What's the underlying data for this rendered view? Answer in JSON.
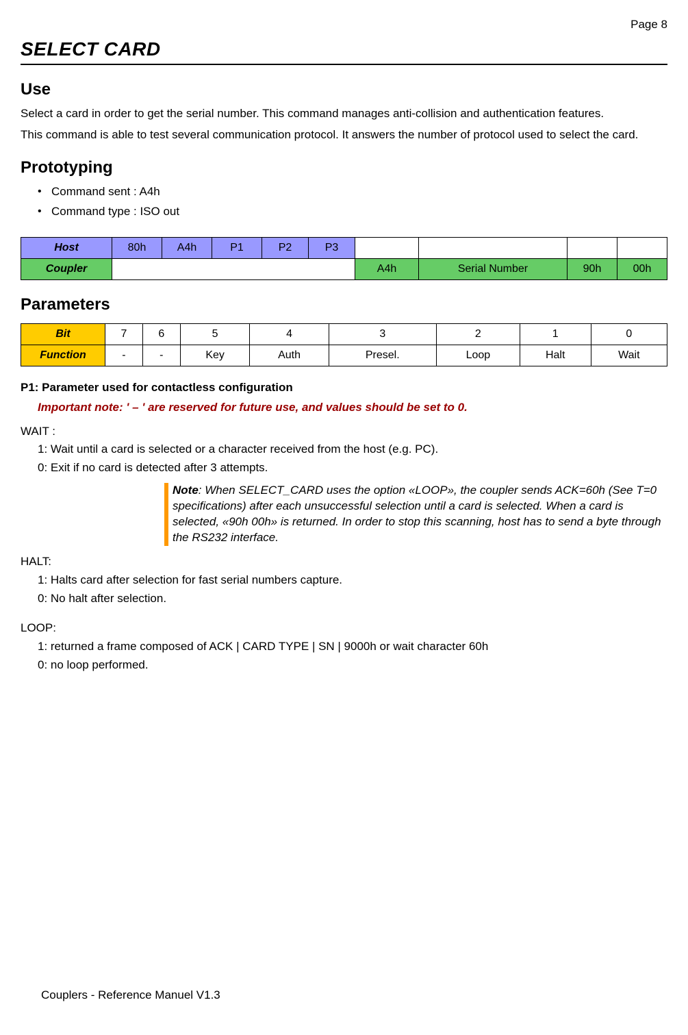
{
  "page_number": "Page 8",
  "title": "SELECT CARD",
  "use": {
    "heading": "Use",
    "p1": "Select a card in order to get the serial number. This command manages anti-collision and  authentication features.",
    "p2": "This command is able to test several communication protocol. It answers the number of protocol used to select the card."
  },
  "proto": {
    "heading": "Prototyping",
    "items": [
      "Command sent : A4h",
      "Command type : ISO out"
    ]
  },
  "cmd_table": {
    "host_label": "Host",
    "host_cells": [
      "80h",
      "A4h",
      "P1",
      "P2",
      "P3"
    ],
    "coupler_label": "Coupler",
    "coupler_cells": [
      "A4h",
      "Serial Number",
      "90h",
      "00h"
    ]
  },
  "params": {
    "heading": "Parameters",
    "bit_label": "Bit",
    "bits": [
      "7",
      "6",
      "5",
      "4",
      "3",
      "2",
      "1",
      "0"
    ],
    "func_label": "Function",
    "funcs": [
      "-",
      "-",
      "Key",
      "Auth",
      "Presel.",
      "Loop",
      "Halt",
      "Wait"
    ]
  },
  "p1_section": {
    "heading": "P1: Parameter used for contactless configuration",
    "important": "Important note: ' – ' are reserved for future use, and values should be set to 0.",
    "wait_label": "WAIT :",
    "wait_1": "1: Wait until a card is selected or a character received from the host (e.g. PC).",
    "wait_0": "0: Exit if no card is detected after 3 attempts.",
    "note_label": "Note",
    "note_text": ": When SELECT_CARD uses the option «LOOP», the coupler sends ACK=60h (See T=0 specifications) after each unsuccessful selection until a card is selected. When a card is selected, «90h 00h» is returned. In order to stop this scanning, host has to send a byte through the RS232 interface.",
    "halt_label": "HALT:",
    "halt_1": "1: Halts card after selection for fast serial numbers capture.",
    "halt_0": "0: No halt after selection.",
    "loop_label": "LOOP:",
    "loop_1": "1: returned a frame composed of ACK |  CARD TYPE |  SN |  9000h or wait character 60h",
    "loop_0": "0: no loop performed."
  },
  "footer": "Couplers - Reference Manuel V1.3"
}
